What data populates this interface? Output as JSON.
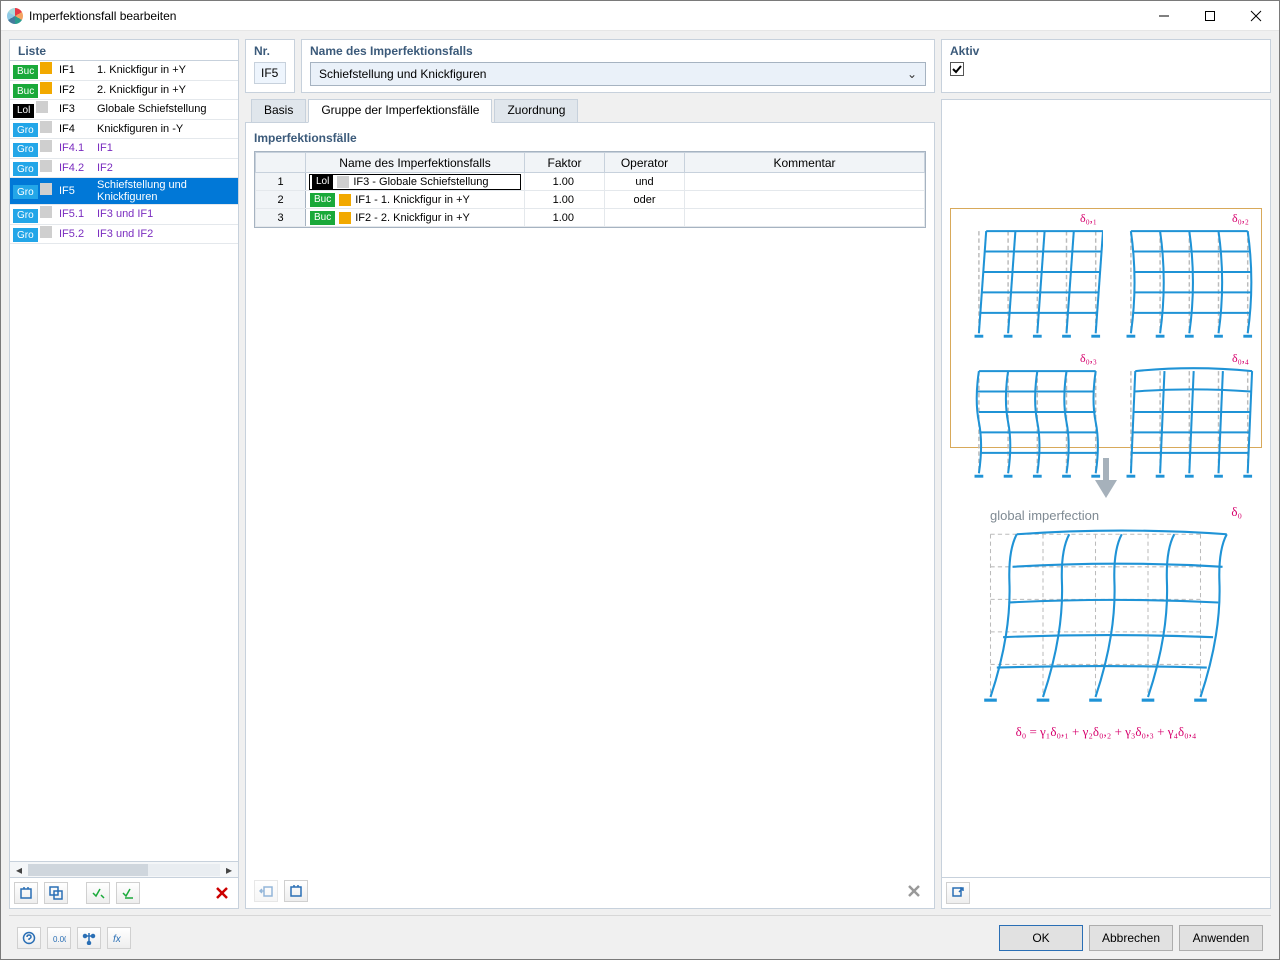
{
  "window": {
    "title": "Imperfektionsfall bearbeiten"
  },
  "left": {
    "header": "Liste",
    "items": [
      {
        "badge": {
          "text": "Buc",
          "bg": "#1aa93a"
        },
        "sq": "#f2a900",
        "id": "IF1",
        "desc": "1. Knickfigur in +Y",
        "sub": false
      },
      {
        "badge": {
          "text": "Buc",
          "bg": "#1aa93a"
        },
        "sq": "#f2a900",
        "id": "IF2",
        "desc": "2. Knickfigur in +Y",
        "sub": false
      },
      {
        "badge": {
          "text": "Lol",
          "bg": "#000000",
          "fg": "#ffffff"
        },
        "sq": "#cfcfcf",
        "id": "IF3",
        "desc": "Globale Schiefstellung",
        "sub": false
      },
      {
        "badge": {
          "text": "Gro",
          "bg": "#23a6e8"
        },
        "sq": "#cfcfcf",
        "id": "IF4",
        "desc": "Knickfiguren in -Y",
        "sub": false
      },
      {
        "badge": {
          "text": "Gro",
          "bg": "#23a6e8"
        },
        "sq": "#cfcfcf",
        "id": "IF4.1",
        "desc": "IF1",
        "sub": true
      },
      {
        "badge": {
          "text": "Gro",
          "bg": "#23a6e8"
        },
        "sq": "#cfcfcf",
        "id": "IF4.2",
        "desc": "IF2",
        "sub": true
      },
      {
        "badge": {
          "text": "Gro",
          "bg": "#23a6e8"
        },
        "sq": "#cfcfcf",
        "id": "IF5",
        "desc": "Schiefstellung und Knickfiguren",
        "sub": false,
        "selected": true
      },
      {
        "badge": {
          "text": "Gro",
          "bg": "#23a6e8"
        },
        "sq": "#cfcfcf",
        "id": "IF5.1",
        "desc": "IF3 und IF1",
        "sub": true
      },
      {
        "badge": {
          "text": "Gro",
          "bg": "#23a6e8"
        },
        "sq": "#cfcfcf",
        "id": "IF5.2",
        "desc": "IF3 und IF2",
        "sub": true
      }
    ]
  },
  "header": {
    "nr_label": "Nr.",
    "nr_value": "IF5",
    "name_label": "Name des Imperfektionsfalls",
    "name_value": "Schiefstellung und Knickfiguren",
    "aktiv_label": "Aktiv",
    "aktiv_checked": true
  },
  "tabs": {
    "basis": "Basis",
    "gruppe": "Gruppe der Imperfektionsfälle",
    "zuordnung": "Zuordnung",
    "active": 1
  },
  "section": {
    "title": "Imperfektionsfälle"
  },
  "table": {
    "cols": {
      "name": "Name des Imperfektionsfalls",
      "faktor": "Faktor",
      "operator": "Operator",
      "kommentar": "Kommentar"
    },
    "rows": [
      {
        "n": "1",
        "badge": {
          "text": "Lol",
          "bg": "#000000"
        },
        "sq": "#cfcfcf",
        "name": "IF3 - Globale Schiefstellung",
        "faktor": "1.00",
        "op": "und",
        "komm": "",
        "first": true
      },
      {
        "n": "2",
        "badge": {
          "text": "Buc",
          "bg": "#1aa93a"
        },
        "sq": "#f2a900",
        "name": "IF1 - 1. Knickfigur in +Y",
        "faktor": "1.00",
        "op": "oder",
        "komm": ""
      },
      {
        "n": "3",
        "badge": {
          "text": "Buc",
          "bg": "#1aa93a"
        },
        "sq": "#f2a900",
        "name": "IF2 - 2. Knickfigur in +Y",
        "faktor": "1.00",
        "op": "",
        "komm": ""
      }
    ]
  },
  "preview": {
    "deltas": [
      "δ₀,₁",
      "δ₀,₂",
      "δ₀,₃",
      "δ₀,₄"
    ],
    "global_label": "global imperfection",
    "global_delta": "δ₀",
    "formula": "δ₀ = γ₁δ₀,₁ + γ₂δ₀,₂ + γ₃δ₀,₃ + γ₄δ₀,₄"
  },
  "buttons": {
    "ok": "OK",
    "cancel": "Abbrechen",
    "apply": "Anwenden"
  }
}
